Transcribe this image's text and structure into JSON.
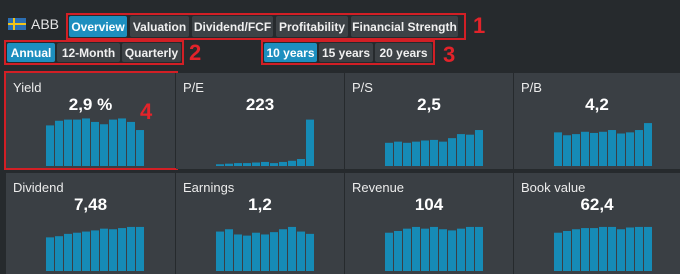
{
  "header": {
    "ticker": "ABB",
    "flag": "sweden-flag-icon"
  },
  "tabs": [
    {
      "label": "Overview",
      "active": true
    },
    {
      "label": "Valuation",
      "active": false
    },
    {
      "label": "Dividend/FCF",
      "active": false
    },
    {
      "label": "Profitability",
      "active": false
    },
    {
      "label": "Financial Strength",
      "active": false
    }
  ],
  "periods": [
    {
      "label": "Annual",
      "active": true
    },
    {
      "label": "12-Month",
      "active": false
    },
    {
      "label": "Quarterly",
      "active": false
    }
  ],
  "ranges": [
    {
      "label": "10 years",
      "active": true
    },
    {
      "label": "15 years",
      "active": false
    },
    {
      "label": "20 years",
      "active": false
    }
  ],
  "annotations": [
    "1",
    "2",
    "3",
    "4"
  ],
  "colors": {
    "accent": "#1d8fbf",
    "bar": "#168bb6",
    "highlight": "#d21f25"
  },
  "tiles": [
    {
      "label": "Yield",
      "value": "2,9 %",
      "bars": [
        0.7,
        0.78,
        0.8,
        0.8,
        0.82,
        0.76,
        0.72,
        0.8,
        0.82,
        0.76,
        0.62
      ]
    },
    {
      "label": "P/E",
      "value": "223",
      "bars": [
        0.03,
        0.04,
        0.05,
        0.05,
        0.06,
        0.07,
        0.05,
        0.07,
        0.09,
        0.12,
        0.8
      ]
    },
    {
      "label": "P/S",
      "value": "2,5",
      "bars": [
        0.4,
        0.42,
        0.4,
        0.42,
        0.44,
        0.45,
        0.42,
        0.48,
        0.55,
        0.54,
        0.62
      ]
    },
    {
      "label": "P/B",
      "value": "4,2",
      "bars": [
        0.58,
        0.53,
        0.55,
        0.59,
        0.57,
        0.59,
        0.62,
        0.56,
        0.58,
        0.62,
        0.74
      ]
    },
    {
      "label": "Dividend",
      "value": "7,48",
      "bars": [
        0.58,
        0.6,
        0.64,
        0.66,
        0.68,
        0.7,
        0.73,
        0.72,
        0.74,
        0.76,
        0.76
      ]
    },
    {
      "label": "Earnings",
      "value": "1,2",
      "bars": [
        0.68,
        0.72,
        0.63,
        0.61,
        0.66,
        0.63,
        0.67,
        0.72,
        0.76,
        0.68,
        0.64
      ]
    },
    {
      "label": "Revenue",
      "value": "104",
      "bars": [
        0.66,
        0.69,
        0.73,
        0.76,
        0.73,
        0.76,
        0.72,
        0.7,
        0.73,
        0.76,
        0.76
      ]
    },
    {
      "label": "Book value",
      "value": "62,4",
      "bars": [
        0.66,
        0.69,
        0.72,
        0.74,
        0.74,
        0.76,
        0.76,
        0.72,
        0.75,
        0.76,
        0.76
      ]
    }
  ]
}
